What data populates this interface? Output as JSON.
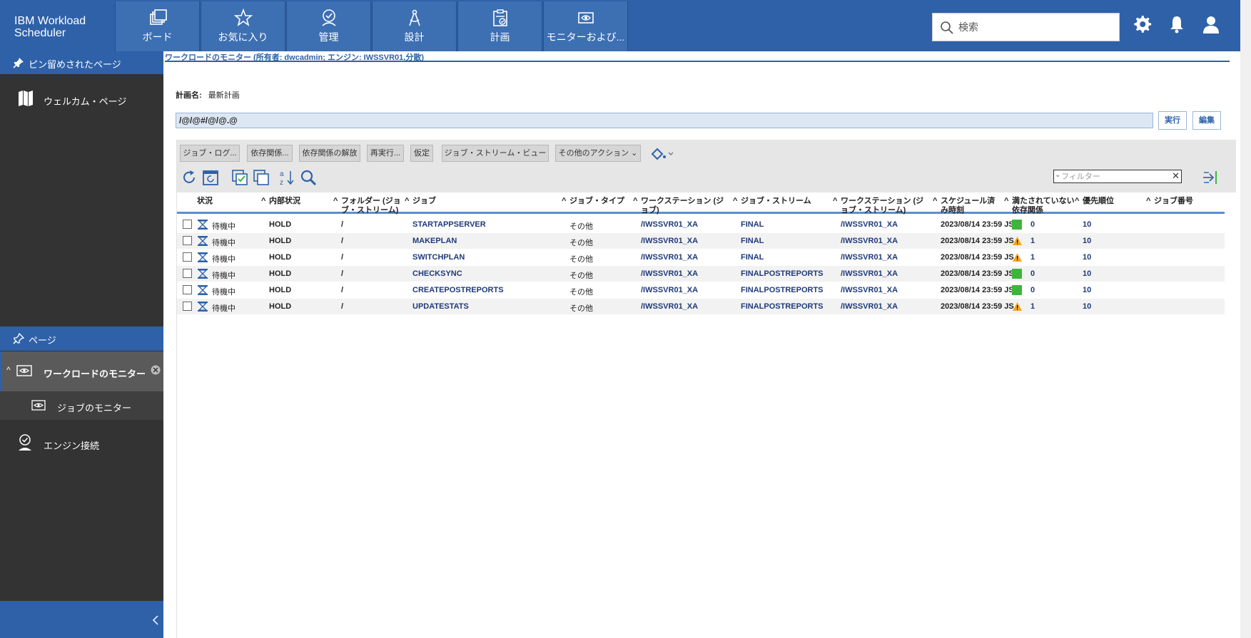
{
  "app": {
    "brand": "IBM Workload Scheduler"
  },
  "nav": {
    "tabs": [
      {
        "label": "ボード",
        "icon": "boards-icon"
      },
      {
        "label": "お気に入り",
        "icon": "star-icon"
      },
      {
        "label": "管理",
        "icon": "admin-check-icon"
      },
      {
        "label": "設計",
        "icon": "compass-icon"
      },
      {
        "label": "計画",
        "icon": "clipboard-check-icon"
      },
      {
        "label": "モニターおよび...",
        "icon": "monitor-eye-icon"
      }
    ]
  },
  "search": {
    "placeholder": "検索"
  },
  "sidebar": {
    "pinned_header": "ピン留めされたページ",
    "welcome_label": "ウェルカム・ページ",
    "pages_header": "ページ",
    "workload_monitor_label": "ワークロードのモニター",
    "job_monitor_label": "ジョブのモニター",
    "engine_connection_label": "エンジン接続"
  },
  "main": {
    "title": "ワークロードのモニター (所有者: dwcadmin; エンジン: IWSSVR01,分散)",
    "plan_name_label": "計画名:",
    "plan_name_value": "最新計画",
    "query": "/@/@#/@/@.@",
    "run_label": "実行",
    "edit_label": "編集"
  },
  "toolbar": {
    "buttons": [
      "ジョブ・ログ...",
      "依存関係...",
      "依存関係の解放",
      "再実行...",
      "仮定",
      "ジョブ・ストリーム・ビュー",
      "その他のアクション"
    ],
    "filter_placeholder": "フィルター"
  },
  "table": {
    "columns": [
      "状況",
      "内部状況",
      "フォルダー (ジョブ・ストリーム)",
      "ジョブ",
      "ジョブ・タイプ",
      "ワークステーション (ジョブ)",
      "ジョブ・ストリーム",
      "ワークステーション (ジョブ・ストリーム)",
      "スケジュール済み時刻",
      "満たされていない依存関係",
      "優先順位",
      "ジョブ番号"
    ],
    "rows": [
      {
        "status": "待機中",
        "internal": "HOLD",
        "folder": "/",
        "job": "STARTAPPSERVER",
        "type": "その他",
        "ws_job": "/IWSSVR01_XA",
        "stream": "FINAL",
        "ws_stream": "/IWSSVR01_XA",
        "sched": "2023/08/14 23:59 JS",
        "deps_state": "ok",
        "deps": "0",
        "priority": "10",
        "job_no": ""
      },
      {
        "status": "待機中",
        "internal": "HOLD",
        "folder": "/",
        "job": "MAKEPLAN",
        "type": "その他",
        "ws_job": "/IWSSVR01_XA",
        "stream": "FINAL",
        "ws_stream": "/IWSSVR01_XA",
        "sched": "2023/08/14 23:59 JS",
        "deps_state": "warn",
        "deps": "1",
        "priority": "10",
        "job_no": ""
      },
      {
        "status": "待機中",
        "internal": "HOLD",
        "folder": "/",
        "job": "SWITCHPLAN",
        "type": "その他",
        "ws_job": "/IWSSVR01_XA",
        "stream": "FINAL",
        "ws_stream": "/IWSSVR01_XA",
        "sched": "2023/08/14 23:59 JS",
        "deps_state": "warn",
        "deps": "1",
        "priority": "10",
        "job_no": ""
      },
      {
        "status": "待機中",
        "internal": "HOLD",
        "folder": "/",
        "job": "CHECKSYNC",
        "type": "その他",
        "ws_job": "/IWSSVR01_XA",
        "stream": "FINALPOSTREPORTS",
        "ws_stream": "/IWSSVR01_XA",
        "sched": "2023/08/14 23:59 JS",
        "deps_state": "ok",
        "deps": "0",
        "priority": "10",
        "job_no": ""
      },
      {
        "status": "待機中",
        "internal": "HOLD",
        "folder": "/",
        "job": "CREATEPOSTREPORTS",
        "type": "その他",
        "ws_job": "/IWSSVR01_XA",
        "stream": "FINALPOSTREPORTS",
        "ws_stream": "/IWSSVR01_XA",
        "sched": "2023/08/14 23:59 JS",
        "deps_state": "ok",
        "deps": "0",
        "priority": "10",
        "job_no": ""
      },
      {
        "status": "待機中",
        "internal": "HOLD",
        "folder": "/",
        "job": "UPDATESTATS",
        "type": "その他",
        "ws_job": "/IWSSVR01_XA",
        "stream": "FINALPOSTREPORTS",
        "ws_stream": "/IWSSVR01_XA",
        "sched": "2023/08/14 23:59 JS",
        "deps_state": "warn",
        "deps": "1",
        "priority": "10",
        "job_no": ""
      }
    ]
  },
  "colors": {
    "brand_blue": "#2e61a8",
    "sidebar_dark": "#333333",
    "ok_green": "#3db53a",
    "warn_orange": "#f5a623"
  }
}
